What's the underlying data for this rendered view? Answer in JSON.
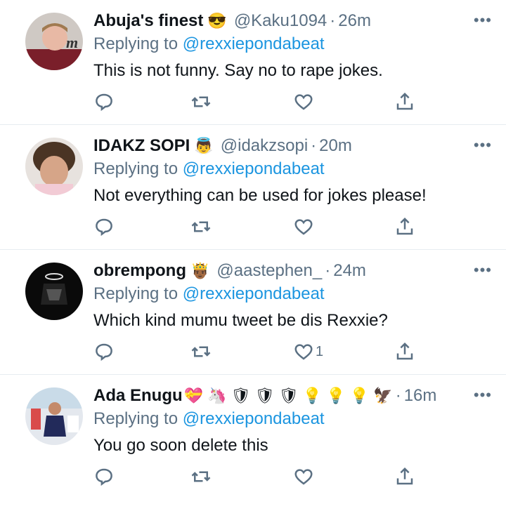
{
  "tweets": [
    {
      "name": "Abuja's finest",
      "emoji": "😎",
      "handle": "@Kaku1094",
      "time": "26m",
      "reply_prefix": "Replying to",
      "reply_to": "@rexxiepondabeat",
      "text": "This is not funny. Say no to rape jokes.",
      "like_count": ""
    },
    {
      "name": "IDAKZ SOPI",
      "emoji": "👼",
      "handle": "@idakzsopi",
      "time": "20m",
      "reply_prefix": "Replying to",
      "reply_to": "@rexxiepondabeat",
      "text": "Not everything can be used for jokes please!",
      "like_count": ""
    },
    {
      "name": "obrempong",
      "emoji": "🤴🏾",
      "handle": "@aastephen_",
      "time": "24m",
      "reply_prefix": "Replying to",
      "reply_to": "@rexxiepondabeat",
      "text": "Which kind mumu tweet be dis Rexxie?",
      "like_count": "1"
    },
    {
      "name": "Ada Enugu",
      "emoji": "💝 🦄 🛡 🛡 🛡 💡 💡 💡 🦅",
      "handle": "",
      "time": "16m",
      "reply_prefix": "Replying to",
      "reply_to": "@rexxiepondabeat",
      "text": "You go soon delete this",
      "like_count": ""
    }
  ],
  "colors": {
    "secondary": "#5b7083",
    "link": "#1b95e0",
    "divider": "#e6ecf0"
  },
  "icons": [
    "reply-icon",
    "retweet-icon",
    "like-icon",
    "share-icon",
    "more-icon"
  ]
}
